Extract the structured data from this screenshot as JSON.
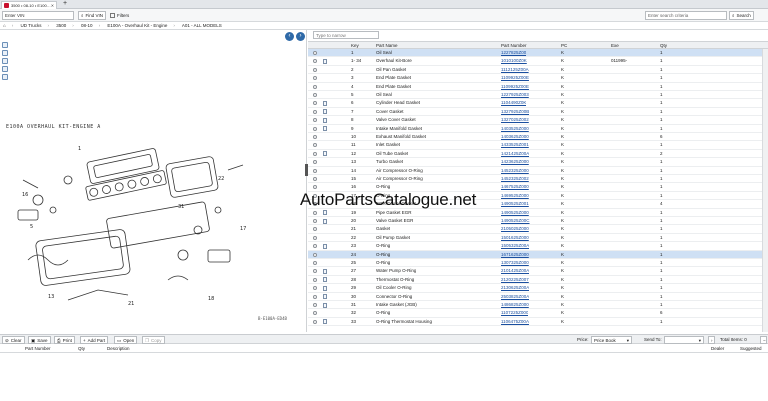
{
  "tab": {
    "title": "3500 • 08-10 • E100…"
  },
  "toolbar": {
    "vin_placeholder": "Enter VIN",
    "find_vin": "Find VIN",
    "filters": "Filters",
    "search_placeholder": "Enter search criteria",
    "search_btn": "Search"
  },
  "breadcrumb": [
    "UD Trucks",
    "3500",
    "08-10",
    "E100A - Overhaul Kit - Engine",
    "A01 - ALL MODELS"
  ],
  "diagram": {
    "title": "E100A OVERHAUL KIT-ENGINE  A",
    "code": "B-E100A-ED4B"
  },
  "parts": {
    "type_placeholder": "Type to narrow",
    "headers": {
      "key": "Key",
      "name": "Part Name",
      "number": "Part Number",
      "pc": "PC",
      "exe": "Exe",
      "qty": "Qty"
    },
    "rows": [
      {
        "key": "1",
        "name": "Oil Seal",
        "number": "1227825Z00",
        "pc": "K",
        "exe": "",
        "qty": "1",
        "doc": false,
        "sel": true
      },
      {
        "key": "1- 34",
        "name": "Overhaul Kit-Bore",
        "number": "1010100Z0K",
        "pc": "K",
        "exe": "011995-",
        "qty": "1",
        "doc": true,
        "sel": false
      },
      {
        "key": "2",
        "name": "Oil Pan Gasket",
        "number": "1112125Z00A",
        "pc": "K",
        "exe": "",
        "qty": "1",
        "doc": false,
        "sel": false
      },
      {
        "key": "3",
        "name": "End Plate Gasket",
        "number": "1109925Z00E",
        "pc": "K",
        "exe": "",
        "qty": "1",
        "doc": false,
        "sel": false
      },
      {
        "key": "4",
        "name": "End Plate Gasket",
        "number": "1109925Z00E",
        "pc": "K",
        "exe": "",
        "qty": "1",
        "doc": false,
        "sel": false
      },
      {
        "key": "5",
        "name": "Oil Seal",
        "number": "1227925Z003",
        "pc": "K",
        "exe": "",
        "qty": "1",
        "doc": false,
        "sel": false
      },
      {
        "key": "6",
        "name": "Cylinder Head Gasket",
        "number": "1104490Z0K",
        "pc": "K",
        "exe": "",
        "qty": "1",
        "doc": true,
        "sel": false
      },
      {
        "key": "7",
        "name": "Cover Gasket",
        "number": "1327925Z00B",
        "pc": "K",
        "exe": "",
        "qty": "1",
        "doc": true,
        "sel": false
      },
      {
        "key": "8",
        "name": "Valve Cover Gasket",
        "number": "1327025Z002",
        "pc": "K",
        "exe": "",
        "qty": "1",
        "doc": true,
        "sel": false
      },
      {
        "key": "9",
        "name": "Intake Manifold Gasket",
        "number": "1403525Z000",
        "pc": "K",
        "exe": "",
        "qty": "1",
        "doc": true,
        "sel": false
      },
      {
        "key": "10",
        "name": "Exhaust Manifold Gasket",
        "number": "1403625Z000",
        "pc": "K",
        "exe": "",
        "qty": "6",
        "doc": false,
        "sel": false
      },
      {
        "key": "11",
        "name": "Inlet Gasket",
        "number": "1433525Z001",
        "pc": "K",
        "exe": "",
        "qty": "1",
        "doc": false,
        "sel": false
      },
      {
        "key": "12",
        "name": "Oil Tube Gasket",
        "number": "1421425Z00A",
        "pc": "K",
        "exe": "",
        "qty": "2",
        "doc": true,
        "sel": false
      },
      {
        "key": "13",
        "name": "Turbo Gasket",
        "number": "1423625Z000",
        "pc": "K",
        "exe": "",
        "qty": "1",
        "doc": false,
        "sel": false
      },
      {
        "key": "14",
        "name": "Air Compressor O-Ring",
        "number": "1452325Z000",
        "pc": "K",
        "exe": "",
        "qty": "1",
        "doc": false,
        "sel": false
      },
      {
        "key": "15",
        "name": "Air Compressor O-Ring",
        "number": "1452325Z002",
        "pc": "K",
        "exe": "",
        "qty": "1",
        "doc": false,
        "sel": false
      },
      {
        "key": "16",
        "name": "O-Ring",
        "number": "1467525Z000",
        "pc": "K",
        "exe": "",
        "qty": "1",
        "doc": false,
        "sel": false
      },
      {
        "key": "17",
        "name": "O-Ring",
        "number": "1469525Z000",
        "pc": "K",
        "exe": "",
        "qty": "1",
        "doc": false,
        "sel": false
      },
      {
        "key": "18",
        "name": "EGR Cooler Gasket",
        "number": "1490525Z001",
        "pc": "K",
        "exe": "",
        "qty": "4",
        "doc": false,
        "sel": false
      },
      {
        "key": "19",
        "name": "Pipe Gasket EGR",
        "number": "1490525Z000",
        "pc": "K",
        "exe": "",
        "qty": "1",
        "doc": true,
        "sel": false
      },
      {
        "key": "20",
        "name": "Valve Gasket EGR",
        "number": "1490525Z00C",
        "pc": "K",
        "exe": "",
        "qty": "1",
        "doc": true,
        "sel": false
      },
      {
        "key": "21",
        "name": "Gasket",
        "number": "2105025Z000",
        "pc": "K",
        "exe": "",
        "qty": "1",
        "doc": false,
        "sel": false
      },
      {
        "key": "22",
        "name": "Oil Pump Gasket",
        "number": "1501625Z000",
        "pc": "K",
        "exe": "",
        "qty": "1",
        "doc": false,
        "sel": false
      },
      {
        "key": "23",
        "name": "O-Ring",
        "number": "1505325Z00A",
        "pc": "K",
        "exe": "",
        "qty": "1",
        "doc": true,
        "sel": false
      },
      {
        "key": "24",
        "name": "O-Ring",
        "number": "1671625Z000",
        "pc": "K",
        "exe": "",
        "qty": "1",
        "doc": false,
        "sel": true
      },
      {
        "key": "25",
        "name": "O-Ring",
        "number": "1307325Z000",
        "pc": "K",
        "exe": "",
        "qty": "1",
        "doc": false,
        "sel": false
      },
      {
        "key": "27",
        "name": "Water Pump O-Ring",
        "number": "2101425Z00A",
        "pc": "K",
        "exe": "",
        "qty": "1",
        "doc": true,
        "sel": false
      },
      {
        "key": "28",
        "name": "Thermostat O-Ring",
        "number": "2120225Z007",
        "pc": "K",
        "exe": "",
        "qty": "1",
        "doc": true,
        "sel": false
      },
      {
        "key": "29",
        "name": "Oil Cooler O-Ring",
        "number": "2130625Z00A",
        "pc": "K",
        "exe": "",
        "qty": "1",
        "doc": true,
        "sel": false
      },
      {
        "key": "30",
        "name": "Connector O-Ring",
        "number": "2503825Z00A",
        "pc": "K",
        "exe": "",
        "qty": "1",
        "doc": true,
        "sel": false
      },
      {
        "key": "31",
        "name": "Intake Gasket (JGB)",
        "number": "1486825Z000",
        "pc": "K",
        "exe": "",
        "qty": "1",
        "doc": true,
        "sel": false
      },
      {
        "key": "32",
        "name": "O-Ring",
        "number": "1107225Z000",
        "pc": "K",
        "exe": "",
        "qty": "6",
        "doc": false,
        "sel": false
      },
      {
        "key": "33",
        "name": "O-Ring Thermostat Housing",
        "number": "1106475Z00A",
        "pc": "K",
        "exe": "",
        "qty": "1",
        "doc": true,
        "sel": false
      }
    ]
  },
  "watermark": "AutoPartsCatalogue.net",
  "bottom": {
    "clear": "Clear",
    "save": "Save",
    "print": "Print",
    "add_part": "Add Part",
    "open": "Open",
    "copy": "Copy",
    "price_label": "Price:",
    "price_value": "Price Book",
    "send_to_label": "Send To:",
    "total_items": "Total Items: 0",
    "headers": {
      "part_number": "Part Number",
      "qty": "Qty",
      "description": "Description",
      "dealer": "Dealer",
      "suggested": "Suggested"
    }
  }
}
